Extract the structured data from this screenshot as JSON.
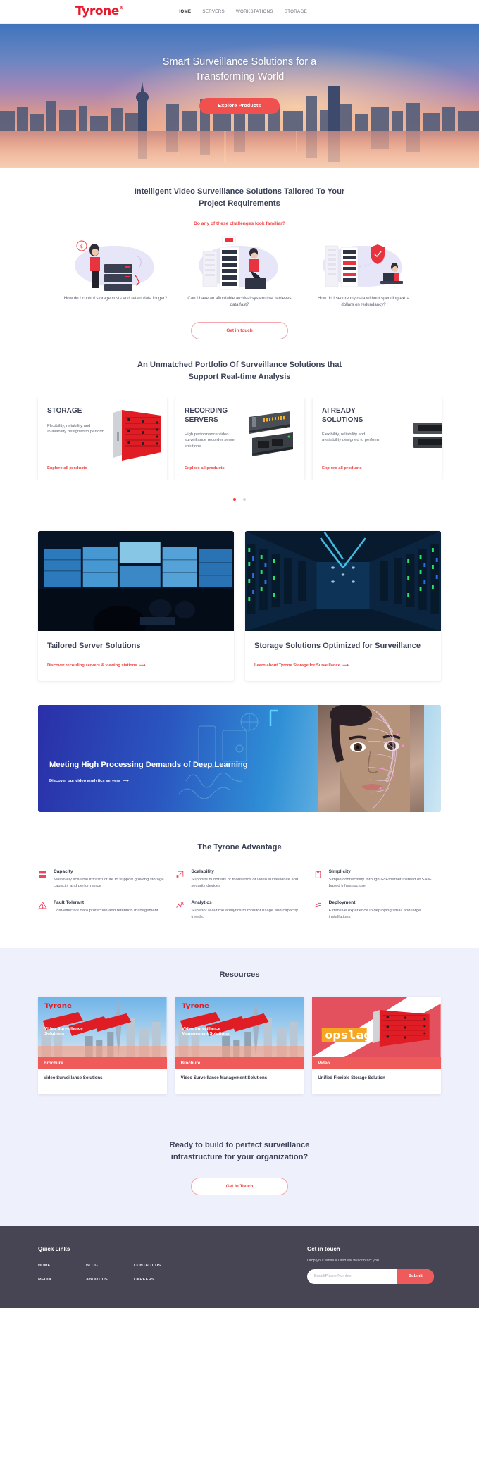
{
  "header": {
    "logo": "Tyrone",
    "logo_mark": "registered-trademark",
    "nav": [
      {
        "label": "HOME",
        "active": true
      },
      {
        "label": "SERVERS",
        "active": false
      },
      {
        "label": "WORKSTATIONS",
        "active": false
      },
      {
        "label": "STORAGE",
        "active": false
      }
    ]
  },
  "hero": {
    "title": "Smart Surveillance Solutions for a Transforming World",
    "cta": "Explore Products",
    "cta_color": "#f0514f"
  },
  "challenges": {
    "title": "Intelligent Video Surveillance Solutions Tailored To Your Project Requirements",
    "subtitle": "Do any of these challenges look familiar?",
    "subtitle_color": "#ef4444",
    "items": [
      {
        "text": "How do I control storage costs and retain data longer?",
        "art": "woman-with-storage-rack-illustration"
      },
      {
        "text": "Can I have an affordable archival system that retrieves data fast?",
        "art": "man-on-server-illustration"
      },
      {
        "text": "How do I secure my data without spending extra dollars on redundancy?",
        "art": "secure-data-shield-illustration"
      }
    ],
    "cta": "Get in touch"
  },
  "portfolio": {
    "title": "An Unmatched Portfolio Of Surveillance Solutions that Support Real-time Analysis",
    "cards": [
      {
        "title": "STORAGE",
        "desc": "Flexibility, reliability and availability designed to perform",
        "link": "Explore all products",
        "image": "red-storage-array-photo"
      },
      {
        "title": "RECORDING SERVERS",
        "desc": "High performance video surveillance recorder server solutions",
        "link": "Explore all products",
        "image": "rackmount-servers-photo"
      },
      {
        "title": "AI READY SOLUTIONS",
        "desc": "Flexibility, reliability and availability designed to perform",
        "link": "Explore all products",
        "image": "ai-server-photo"
      }
    ],
    "dots": [
      {
        "active": true
      },
      {
        "active": false
      }
    ]
  },
  "features": [
    {
      "title": "Tailored Server Solutions",
      "link": "Discover recording servers & viewing stations",
      "image": "video-wall-control-room-photo"
    },
    {
      "title": "Storage Solutions Optimized for Surveillance",
      "link": "Learn about Tyrone Storage for Surveillance",
      "image": "data-center-aisle-photo"
    }
  ],
  "deep_learning": {
    "title": "Meeting High Processing Demands of Deep Learning",
    "link": "Discover our video analytics servers",
    "image": "facial-recognition-mesh-photo"
  },
  "advantage": {
    "title": "The Tyrone Advantage",
    "items": [
      {
        "icon": "server-rack-icon",
        "title": "Capacity",
        "desc": "Massively scalable infrastructure to support growing storage capacity and performance"
      },
      {
        "icon": "expand-arrow-icon",
        "title": "Scalability",
        "desc": "Supports hundreds or thousands of video surveillance and security devices"
      },
      {
        "icon": "clipboard-icon",
        "title": "Simplicity",
        "desc": "Simple connectivity through IP Ethernet instead of SAN-based infrastructure"
      },
      {
        "icon": "warning-triangle-icon",
        "title": "Fault Tolerant",
        "desc": "Cost-effective data protection and retention management"
      },
      {
        "icon": "analytics-graph-icon",
        "title": "Analytics",
        "desc": "Superior real-time analytics to monitor usage and capacity trends."
      },
      {
        "icon": "deploy-crosshair-icon",
        "title": "Deployment",
        "desc": "Extensive experience in deploying small and large installations"
      }
    ]
  },
  "resources": {
    "title": "Resources",
    "background": "#eef0fc",
    "cards": [
      {
        "tag": "Brochure",
        "caption": "Video Surveillance Solutions",
        "thumb_brand": "Tyrone",
        "thumb_overlay": "Video Surveillance Solutions",
        "thumb": "city-skyline-brochure-cover"
      },
      {
        "tag": "Brochure",
        "caption": "Video Surveillance Management Solutions",
        "thumb_brand": "Tyrone",
        "thumb_overlay": "Video Surveillance Management Solutions",
        "thumb": "city-skyline-brochure-cover"
      },
      {
        "tag": "Video",
        "caption": "Unified Flexible Storage Solution",
        "thumb_brand": "opslag",
        "thumb_overlay": "",
        "thumb": "opslag-storage-video-cover"
      }
    ],
    "cta_title": "Ready to build to perfect surveillance infrastructure for your organization?",
    "cta": "Get in Touch"
  },
  "footer": {
    "background": "#474554",
    "quick_links_title": "Quick Links",
    "quick_links": [
      "HOME",
      "BLOG",
      "CONTACT US",
      "MEDIA",
      "ABOUT US",
      "CAREERS"
    ],
    "get_in_touch_title": "Get in touch",
    "get_in_touch_desc": "Drop your email ID and we will contact you",
    "input_placeholder": "Email/Phone Number",
    "input_value": "",
    "submit_label": "Submit",
    "submit_color": "#ef5a5a"
  }
}
